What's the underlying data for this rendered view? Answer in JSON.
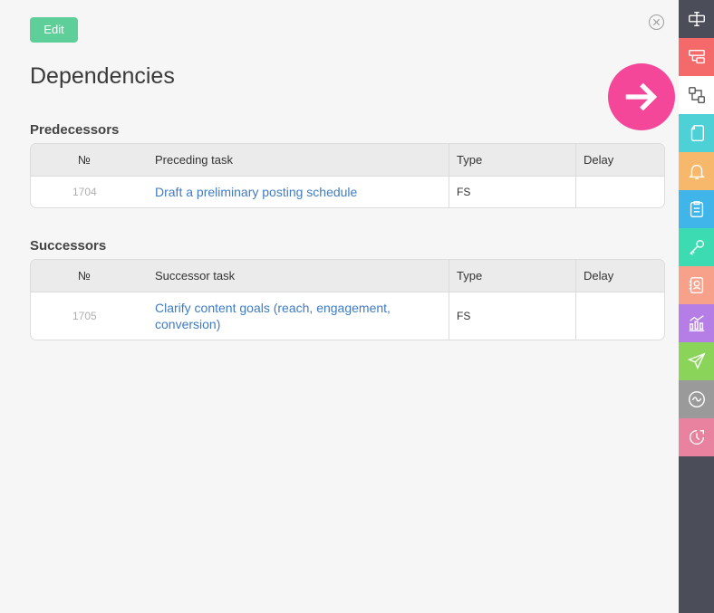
{
  "toolbar": {
    "edit_label": "Edit"
  },
  "page": {
    "title": "Dependencies"
  },
  "predecessors": {
    "title": "Predecessors",
    "headers": {
      "no": "№",
      "task": "Preceding task",
      "type": "Type",
      "delay": "Delay"
    },
    "rows": [
      {
        "no": "1704",
        "task": "Draft a preliminary posting schedule",
        "type": "FS",
        "delay": ""
      }
    ]
  },
  "successors": {
    "title": "Successors",
    "headers": {
      "no": "№",
      "task": "Successor task",
      "type": "Type",
      "delay": "Delay"
    },
    "rows": [
      {
        "no": "1705",
        "task": "Clarify content goals (reach, engagement, conversion)",
        "type": "FS",
        "delay": ""
      }
    ]
  },
  "sidebar": {
    "items": [
      {
        "icon": "text-cursor-icon",
        "color": "#4b4d59"
      },
      {
        "icon": "subtask-icon",
        "color": "#f46a6a"
      },
      {
        "icon": "dependencies-icon",
        "color": "#ffffff"
      },
      {
        "icon": "document-icon",
        "color": "#4dd0d6"
      },
      {
        "icon": "bell-icon",
        "color": "#f7b86b"
      },
      {
        "icon": "checklist-icon",
        "color": "#3fb5ea"
      },
      {
        "icon": "key-icon",
        "color": "#3ddbb1"
      },
      {
        "icon": "contact-icon",
        "color": "#f7a08a"
      },
      {
        "icon": "chart-icon",
        "color": "#b57ee6"
      },
      {
        "icon": "send-icon",
        "color": "#8bd45a"
      },
      {
        "icon": "sync-icon",
        "color": "#9a9a9a"
      },
      {
        "icon": "clock-icon",
        "color": "#e8829e"
      }
    ]
  },
  "colors": {
    "accent": "#5ecf98",
    "link": "#3f7cc4",
    "highlight": "#f5479a"
  }
}
